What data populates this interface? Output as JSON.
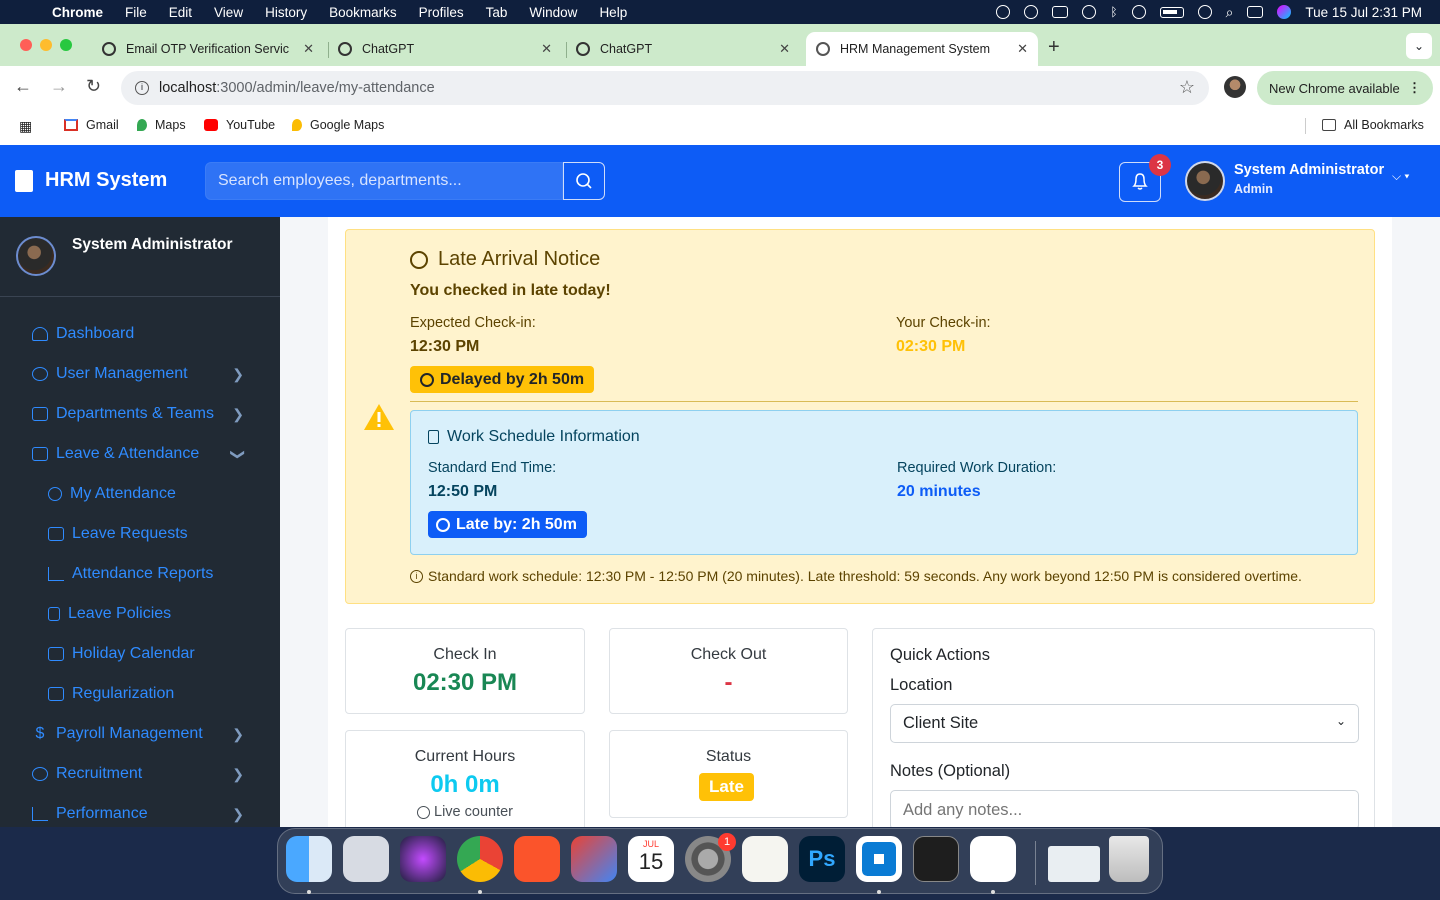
{
  "menubar": {
    "app": "Chrome",
    "items": [
      "File",
      "Edit",
      "View",
      "History",
      "Bookmarks",
      "Profiles",
      "Tab",
      "Window",
      "Help"
    ],
    "datetime": "Tue 15 Jul  2:31 PM"
  },
  "browser": {
    "tabs": [
      {
        "label": "Email OTP Verification Servic"
      },
      {
        "label": "ChatGPT"
      },
      {
        "label": "ChatGPT"
      },
      {
        "label": "HRM Management System"
      }
    ],
    "url_host": "localhost",
    "url_path": ":3000/admin/leave/my-attendance",
    "update_label": "New Chrome available",
    "bookmarks": [
      "Gmail",
      "Maps",
      "YouTube",
      "Google Maps"
    ],
    "all_bookmarks": "All Bookmarks"
  },
  "app": {
    "brand": "HRM System",
    "search_placeholder": "Search employees, departments...",
    "notification_count": "3",
    "user_name": "System Administrator",
    "user_role": "Admin"
  },
  "sidebar": {
    "user_name": "System Administrator",
    "items": [
      {
        "label": "Dashboard"
      },
      {
        "label": "User Management"
      },
      {
        "label": "Departments & Teams"
      },
      {
        "label": "Leave & Attendance"
      },
      {
        "label": "My Attendance"
      },
      {
        "label": "Leave Requests"
      },
      {
        "label": "Attendance Reports"
      },
      {
        "label": "Leave Policies"
      },
      {
        "label": "Holiday Calendar"
      },
      {
        "label": "Regularization"
      },
      {
        "label": "Payroll Management"
      },
      {
        "label": "Recruitment"
      },
      {
        "label": "Performance"
      }
    ],
    "payroll_icon": "$"
  },
  "late_notice": {
    "title": "Late Arrival Notice",
    "subtitle": "You checked in late today!",
    "expected_label": "Expected Check-in:",
    "expected_value": "12:30 PM",
    "actual_label": "Your Check-in:",
    "actual_value": "02:30 PM",
    "delay_badge": "Delayed by 2h 50m",
    "schedule": {
      "title": "Work Schedule Information",
      "end_label": "Standard End Time:",
      "end_value": "12:50 PM",
      "duration_label": "Required Work Duration:",
      "duration_value": "20 minutes",
      "late_badge": "Late by: 2h 50m"
    },
    "note": "Standard work schedule: 12:30 PM - 12:50 PM (20 minutes). Late threshold: 59 seconds. Any work beyond 12:50 PM is considered overtime."
  },
  "stats": {
    "check_in_label": "Check In",
    "check_in_value": "02:30 PM",
    "check_out_label": "Check Out",
    "check_out_value": "-",
    "hours_label": "Current Hours",
    "hours_value": "0h 0m",
    "live_counter": "Live counter",
    "status_label": "Status",
    "status_value": "Late"
  },
  "quick_actions": {
    "title": "Quick Actions",
    "location_label": "Location",
    "location_value": "Client Site",
    "notes_label": "Notes (Optional)",
    "notes_placeholder": "Add any notes..."
  },
  "dock": {
    "calendar_month": "JUL",
    "calendar_day": "15",
    "settings_badge": "1"
  },
  "colors": {
    "primary": "#0d5cf6",
    "sidebar_bg": "#212a34",
    "warning_bg": "#fff3cd",
    "badge_warning": "#ffc107",
    "success": "#198754",
    "danger": "#dc3545"
  }
}
